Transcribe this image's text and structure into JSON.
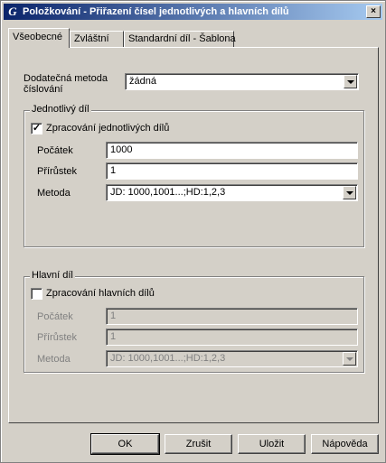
{
  "window": {
    "title": "Položkování - Přiřazení čísel jednotlivých a hlavních dílů",
    "app_icon": "G",
    "close_label": "×"
  },
  "tabs": [
    {
      "label": "Všeobecné",
      "active": true
    },
    {
      "label": "Zvláštní",
      "active": false
    },
    {
      "label": "Standardní díl - Šablona",
      "active": false
    }
  ],
  "extra_numbering": {
    "label": "Dodatečná metoda číslování",
    "value": "žádná"
  },
  "single_part": {
    "group_title": "Jednotlivý díl",
    "checkbox_label": "Zpracování jednotlivých dílů",
    "checked": true,
    "check_mark": "✓",
    "start_label": "Počátek",
    "start_value": "1000",
    "increment_label": "Přírůstek",
    "increment_value": "1",
    "method_label": "Metoda",
    "method_value": "JD: 1000,1001...;HD:1,2,3"
  },
  "main_part": {
    "group_title": "Hlavní díl",
    "checkbox_label": "Zpracování hlavních dílů",
    "checked": false,
    "start_label": "Počátek",
    "start_value": "1",
    "increment_label": "Přírůstek",
    "increment_value": "1",
    "method_label": "Metoda",
    "method_value": "JD: 1000,1001...;HD:1,2,3"
  },
  "buttons": {
    "ok": "OK",
    "cancel": "Zrušit",
    "save": "Uložit",
    "help": "Nápověda"
  }
}
